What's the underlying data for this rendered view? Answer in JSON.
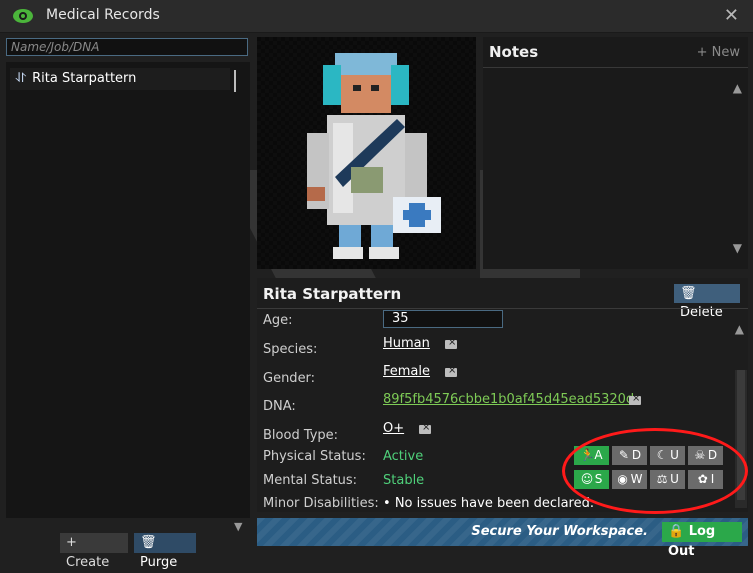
{
  "window": {
    "title": "Medical Records",
    "close_icon": "close-icon",
    "eye_color": "#4bb53b"
  },
  "search": {
    "placeholder": "Name/Job/DNA"
  },
  "records_list": {
    "items": [
      {
        "label": "Rita Starpattern",
        "icon": "dna-icon"
      }
    ]
  },
  "left_buttons": {
    "create_label": "Create",
    "purge_label": "Purge"
  },
  "notes": {
    "title": "Notes",
    "new_label": "New"
  },
  "record": {
    "name": "Rita Starpattern",
    "delete_label": "Delete",
    "fields": {
      "age_label": "Age:",
      "age_value": "35",
      "species_label": "Species:",
      "species_value": "Human",
      "gender_label": "Gender:",
      "gender_value": "Female",
      "dna_label": "DNA:",
      "dna_value": "89f5fb4576cbbe1b0af45d45ead5320d",
      "blood_label": "Blood Type:",
      "blood_value": "O+",
      "physical_label": "Physical Status:",
      "physical_value": "Active",
      "mental_label": "Mental Status:",
      "mental_value": "Stable",
      "minor_label": "Minor Disabilities:",
      "minor_value": "No issues have been declared."
    }
  },
  "status_buttons": [
    {
      "icon": "running-icon",
      "letter": "A",
      "active": true
    },
    {
      "icon": "syringe-icon",
      "letter": "D",
      "active": false
    },
    {
      "icon": "moon-icon",
      "letter": "U",
      "active": false
    },
    {
      "icon": "skull-icon",
      "letter": "D",
      "active": false
    },
    {
      "icon": "smile-icon",
      "letter": "S",
      "active": true
    },
    {
      "icon": "eye-icon",
      "letter": "W",
      "active": false
    },
    {
      "icon": "scales-icon",
      "letter": "U",
      "active": false
    },
    {
      "icon": "brain-icon",
      "letter": "I",
      "active": false
    }
  ],
  "footer": {
    "text": "Secure Your Workspace.",
    "logout_label": "Log Out"
  }
}
